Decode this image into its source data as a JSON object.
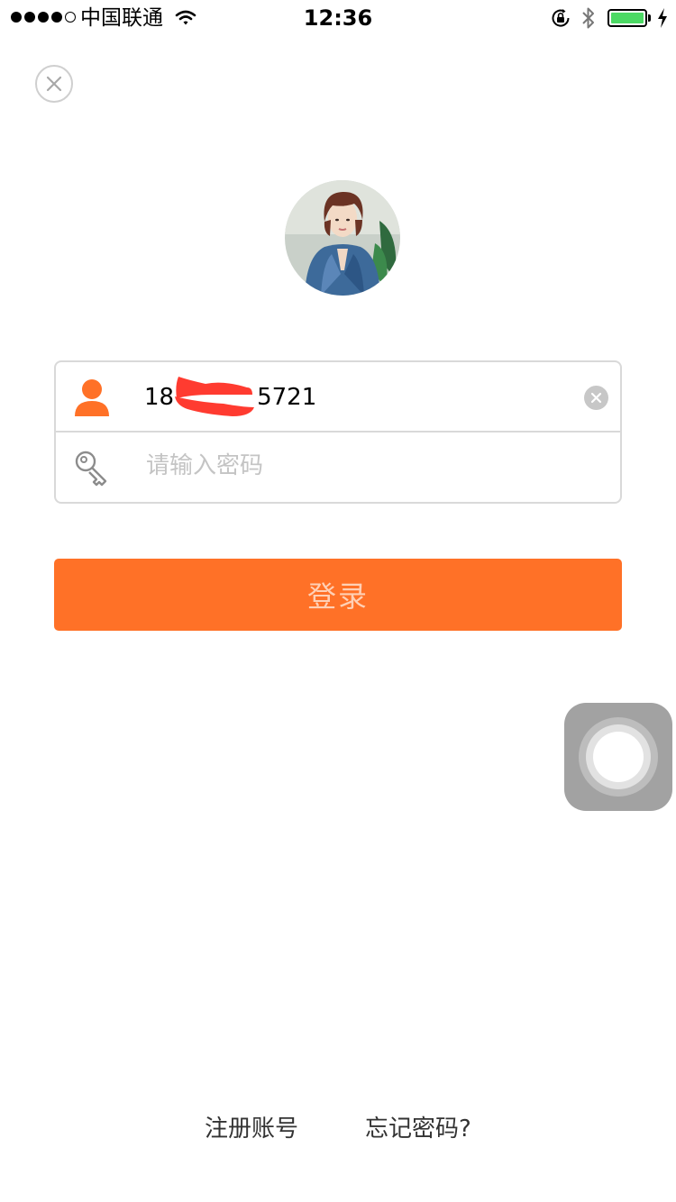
{
  "status_bar": {
    "signal_icon": "signal-dots-icon",
    "carrier": "中国联通",
    "wifi_icon": "wifi-icon",
    "time": "12:36",
    "rotation_lock_icon": "rotation-lock-icon",
    "bluetooth_icon": "bluetooth-icon",
    "battery_icon": "battery-icon",
    "charging_icon": "charging-bolt-icon",
    "battery_color": "#4cd964"
  },
  "header": {
    "close_icon": "close-icon"
  },
  "avatar": {
    "icon": "avatar-photo"
  },
  "form": {
    "account": {
      "icon": "user-icon",
      "value": "18",
      "value_suffix": "5721",
      "clear_icon": "clear-icon"
    },
    "password": {
      "icon": "key-icon",
      "placeholder": "请输入密码"
    }
  },
  "login_button": {
    "label": "登录",
    "color": "#ff7127"
  },
  "assistive_touch": {
    "icon": "assistive-touch-icon"
  },
  "links": {
    "register": "注册账号",
    "forgot": "忘记密码?"
  }
}
